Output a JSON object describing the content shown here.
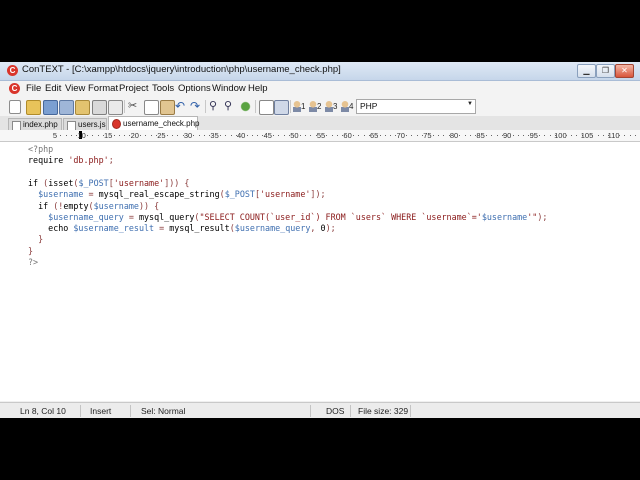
{
  "window": {
    "title": "ConTEXT - [C:\\xampp\\htdocs\\jquery\\introduction\\php\\username_check.php]",
    "app_icon_letter": "C"
  },
  "menu": [
    "File",
    "Edit",
    "View",
    "Format",
    "Project",
    "Tools",
    "Options",
    "Window",
    "Help"
  ],
  "toolbar": {
    "icons": [
      "new-file-icon",
      "open-folder-icon",
      "save-icon",
      "save-all-icon",
      "open-icon",
      "print-icon",
      "print-preview-icon",
      "cut-icon",
      "copy-icon",
      "paste-icon",
      "undo-icon",
      "redo-icon",
      "find-icon",
      "find-next-icon",
      "replace-icon",
      "document-icon",
      "tool-icon"
    ],
    "user_buttons": [
      "1",
      "2",
      "3",
      "4"
    ],
    "language": "PHP"
  },
  "tabs": [
    {
      "label": "index.php",
      "active": false
    },
    {
      "label": "users.js",
      "active": false
    },
    {
      "label": "username_check.php",
      "active": true
    }
  ],
  "ruler": [
    "5",
    "10",
    "15",
    "20",
    "25",
    "30",
    "35",
    "40",
    "45",
    "50",
    "55",
    "60",
    "65",
    "70",
    "75",
    "80",
    "85",
    "90",
    "95",
    "100",
    "105",
    "110"
  ],
  "colors": {
    "keyword": "#000000",
    "variable": "#3f6fb0",
    "string": "#8a1a1a",
    "punctuation": "#8a3b3b",
    "php_tag": "#777777",
    "function": "#000000"
  },
  "code": [
    [
      {
        "t": "<?php",
        "c": "php_tag"
      }
    ],
    [
      {
        "t": "require ",
        "c": "keyword"
      },
      {
        "t": "'db.php'",
        "c": "string"
      },
      {
        "t": ";",
        "c": "punctuation"
      }
    ],
    [],
    [
      {
        "t": "if ",
        "c": "keyword"
      },
      {
        "t": "(",
        "c": "punctuation"
      },
      {
        "t": "isset",
        "c": "keyword"
      },
      {
        "t": "(",
        "c": "punctuation"
      },
      {
        "t": "$_POST",
        "c": "variable"
      },
      {
        "t": "[",
        "c": "punctuation"
      },
      {
        "t": "'username'",
        "c": "string"
      },
      {
        "t": "])) {",
        "c": "punctuation"
      }
    ],
    [
      {
        "t": "  ",
        "c": "keyword"
      },
      {
        "t": "$username",
        "c": "variable"
      },
      {
        "t": " = ",
        "c": "punctuation"
      },
      {
        "t": "mysql_real_escape_string",
        "c": "function"
      },
      {
        "t": "(",
        "c": "punctuation"
      },
      {
        "t": "$_POST",
        "c": "variable"
      },
      {
        "t": "[",
        "c": "punctuation"
      },
      {
        "t": "'username'",
        "c": "string"
      },
      {
        "t": "]);",
        "c": "punctuation"
      }
    ],
    [
      {
        "t": "  if ",
        "c": "keyword"
      },
      {
        "t": "(!",
        "c": "punctuation"
      },
      {
        "t": "empty",
        "c": "keyword"
      },
      {
        "t": "(",
        "c": "punctuation"
      },
      {
        "t": "$username",
        "c": "variable"
      },
      {
        "t": ")) {",
        "c": "punctuation"
      }
    ],
    [
      {
        "t": "    ",
        "c": "keyword"
      },
      {
        "t": "$username_query",
        "c": "variable"
      },
      {
        "t": " = ",
        "c": "punctuation"
      },
      {
        "t": "mysql_query",
        "c": "function"
      },
      {
        "t": "(",
        "c": "punctuation"
      },
      {
        "t": "\"SELECT COUNT(`user_id`) FROM `users` WHERE `username`='",
        "c": "string"
      },
      {
        "t": "$username",
        "c": "variable"
      },
      {
        "t": "'\"",
        "c": "string"
      },
      {
        "t": ");",
        "c": "punctuation"
      }
    ],
    [
      {
        "t": "    echo ",
        "c": "keyword"
      },
      {
        "t": "$username_result",
        "c": "variable"
      },
      {
        "t": " = ",
        "c": "punctuation"
      },
      {
        "t": "mysql_result",
        "c": "function"
      },
      {
        "t": "(",
        "c": "punctuation"
      },
      {
        "t": "$username_query",
        "c": "variable"
      },
      {
        "t": ", ",
        "c": "punctuation"
      },
      {
        "t": "0",
        "c": "keyword"
      },
      {
        "t": ");",
        "c": "punctuation"
      }
    ],
    [
      {
        "t": "  }",
        "c": "punctuation"
      }
    ],
    [
      {
        "t": "}",
        "c": "punctuation"
      }
    ],
    [
      {
        "t": "?>",
        "c": "php_tag"
      }
    ]
  ],
  "status": {
    "position": "Ln 8, Col 10",
    "mode": "Insert",
    "selection": "Sel: Normal",
    "line_ending": "DOS",
    "file_size": "File size: 329"
  }
}
